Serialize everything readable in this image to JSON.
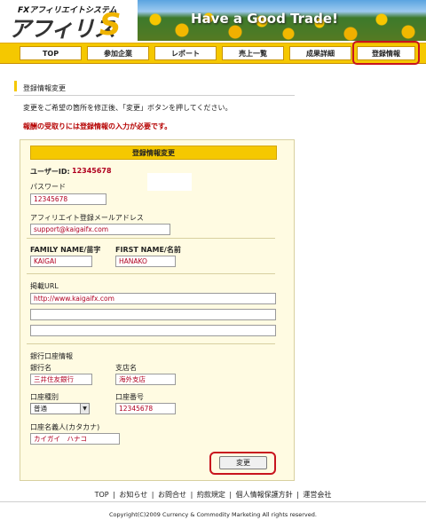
{
  "logo": {
    "subtitle": "FXアフィリエイトシステム",
    "name": "アフィリス"
  },
  "banner": {
    "text": "Have a Good Trade!"
  },
  "nav": {
    "items": [
      {
        "label": "TOP"
      },
      {
        "label": "参加企業"
      },
      {
        "label": "レポート"
      },
      {
        "label": "売上一覧"
      },
      {
        "label": "成果詳細"
      },
      {
        "label": "登録情報"
      }
    ],
    "active": "登録情報"
  },
  "page": {
    "title": "登録情報変更",
    "instruction": "変更をご希望の箇所を修正後、「変更」ボタンを押してください。",
    "warning": "報酬の受取りには登録情報の入力が必要です。"
  },
  "form": {
    "header": "登録情報変更",
    "user_id_label": "ユーザーID:",
    "user_id_value": "12345678",
    "password_label": "パスワード",
    "password_value": "12345678",
    "email_label": "アフィリエイト登録メールアドレス",
    "email_value": "support@kaigaifx.com",
    "family_name_label": "FAMILY NAME/苗字",
    "family_name_value": "KAIGAI",
    "first_name_label": "FIRST NAME/名前",
    "first_name_value": "HANAKO",
    "url_label": "掲載URL",
    "url_values": [
      "http://www.kaigaifx.com",
      "",
      ""
    ],
    "bank_section_label": "銀行口座情報",
    "bank_name_label": "銀行名",
    "bank_name_value": "三井住友銀行",
    "branch_label": "支店名",
    "branch_value": "海外支店",
    "account_type_label": "口座種別",
    "account_type_value": "普通",
    "account_number_label": "口座番号",
    "account_number_value": "12345678",
    "account_holder_label": "口座名義人(カタカナ)",
    "account_holder_value": "カイガイ　ハナコ",
    "submit_label": "変更"
  },
  "footer": {
    "links": [
      "TOP",
      "お知らせ",
      "お問合せ",
      "約款規定",
      "個人情報保護方針",
      "運営会社"
    ],
    "separator": "|",
    "copyright": "Copyright(C)2009 Currency & Commodity Marketing All rights reserved."
  },
  "colors": {
    "accent": "#f5c800",
    "highlight_ring": "#c8141e",
    "value_text": "#b00020",
    "warning_text": "#b50000"
  }
}
